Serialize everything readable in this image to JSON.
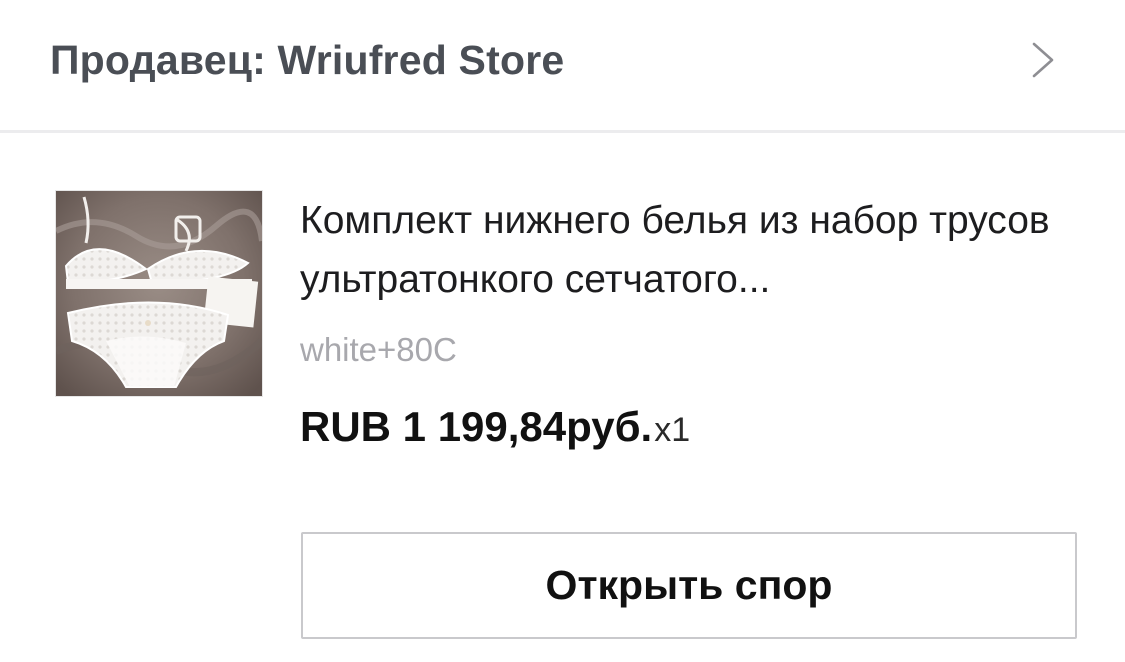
{
  "seller": {
    "label": "Продавец: Wriufred Store",
    "chevron_icon": "chevron-right-icon"
  },
  "product": {
    "image_icon": "product-thumbnail",
    "title": "Комплект нижнего белья из набор трусов ультратонкого сетчатого...",
    "variant": "white+80C",
    "price": "RUB 1 199,84руб.",
    "quantity": "x1"
  },
  "actions": {
    "open_dispute_label": "Открыть спор"
  },
  "colors": {
    "seller_text": "#4a4e55",
    "title_text": "#1d1d1f",
    "variant_text": "#a8a8ad",
    "price_text": "#111111",
    "divider": "#ececee",
    "button_border": "#c9c9cc"
  }
}
